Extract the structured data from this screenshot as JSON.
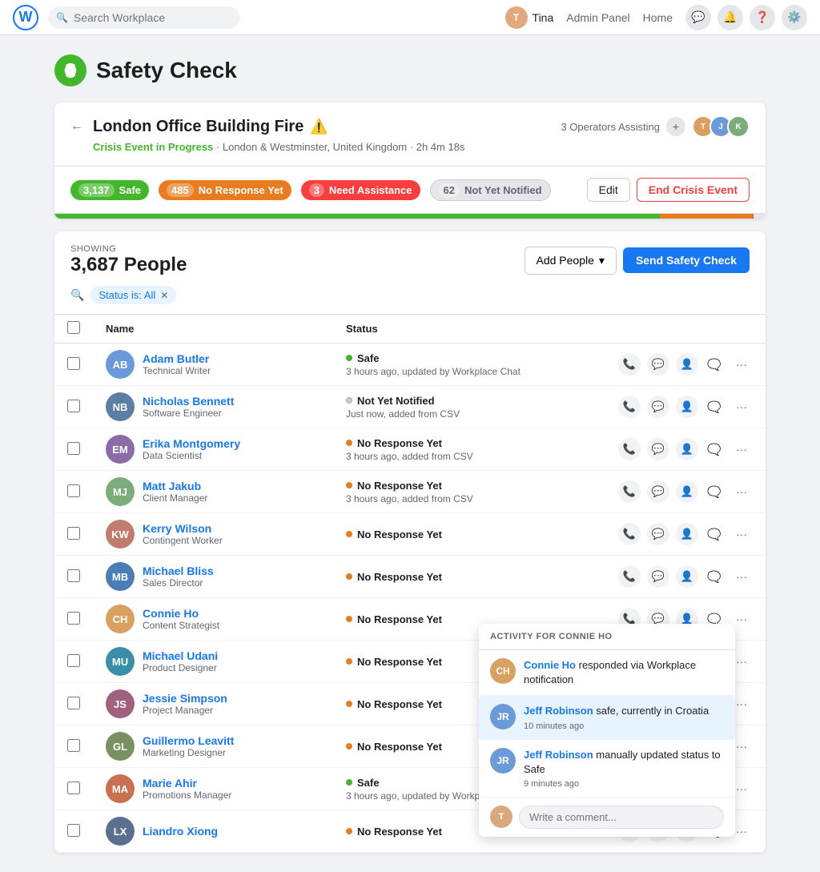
{
  "nav": {
    "logo": "W",
    "search_placeholder": "Search Workplace",
    "user_name": "Tina",
    "links": [
      "Admin Panel",
      "Home"
    ],
    "icons": [
      "chat",
      "notifications",
      "help",
      "settings"
    ]
  },
  "safety_check": {
    "title": "Safety Check",
    "crisis": {
      "name": "London Office Building Fire",
      "status": "Crisis Event in Progress",
      "location": "London & Westminster, United Kingdom",
      "time_ago": "2h 4m 18s",
      "operators_count": "3 Operators Assisting",
      "stats": {
        "safe": {
          "count": "3,137",
          "label": "Safe"
        },
        "no_response": {
          "count": "485",
          "label": "No Response Yet"
        },
        "need_assistance": {
          "count": "3",
          "label": "Need Assistance"
        },
        "not_notified": {
          "count": "62",
          "label": "Not Yet Notified"
        }
      },
      "edit_label": "Edit",
      "end_crisis_label": "End Crisis Event"
    },
    "people": {
      "showing_label": "SHOWING",
      "count": "3,687 People",
      "filter_chip": "Status is: All",
      "add_people_label": "Add People",
      "send_safety_label": "Send Safety Check",
      "columns": [
        "Name",
        "Status"
      ],
      "rows": [
        {
          "name": "Adam Butler",
          "title": "Technical Writer",
          "avatar_color": "#6a9bd8",
          "initials": "AB",
          "status_type": "safe",
          "status_name": "Safe",
          "status_sub": "3 hours ago, updated by Workplace Chat"
        },
        {
          "name": "Nicholas Bennett",
          "title": "Software Engineer",
          "avatar_color": "#5b7fa3",
          "initials": "NB",
          "status_type": "not_notified",
          "status_name": "Not Yet Notified",
          "status_sub": "Just now, added from CSV"
        },
        {
          "name": "Erika Montgomery",
          "title": "Data Scientist",
          "avatar_color": "#8b6ba8",
          "initials": "EM",
          "status_type": "no_response",
          "status_name": "No Response Yet",
          "status_sub": "3 hours ago, added from CSV"
        },
        {
          "name": "Matt Jakub",
          "title": "Client Manager",
          "avatar_color": "#7aad7a",
          "initials": "MJ",
          "status_type": "no_response",
          "status_name": "No Response Yet",
          "status_sub": "3 hours ago, added from CSV"
        },
        {
          "name": "Kerry Wilson",
          "title": "Contingent Worker",
          "avatar_color": "#c27c6e",
          "initials": "KW",
          "status_type": "no_response",
          "status_name": "No Response Yet",
          "status_sub": ""
        },
        {
          "name": "Michael Bliss",
          "title": "Sales Director",
          "avatar_color": "#4a7db5",
          "initials": "MB",
          "status_type": "no_response",
          "status_name": "No Response Yet",
          "status_sub": ""
        },
        {
          "name": "Connie Ho",
          "title": "Content Strategist",
          "avatar_color": "#d9a060",
          "initials": "CH",
          "status_type": "no_response",
          "status_name": "No Response Yet",
          "status_sub": ""
        },
        {
          "name": "Michael Udani",
          "title": "Product Designer",
          "avatar_color": "#3a8fa8",
          "initials": "MU",
          "status_type": "no_response",
          "status_name": "No Response Yet",
          "status_sub": ""
        },
        {
          "name": "Jessie Simpson",
          "title": "Project Manager",
          "avatar_color": "#a06080",
          "initials": "JS",
          "status_type": "no_response",
          "status_name": "No Response Yet",
          "status_sub": ""
        },
        {
          "name": "Guillermo Leavitt",
          "title": "Marketing Designer",
          "avatar_color": "#7a9060",
          "initials": "GL",
          "status_type": "no_response",
          "status_name": "No Response Yet",
          "status_sub": ""
        },
        {
          "name": "Marie Ahir",
          "title": "Promotions Manager",
          "avatar_color": "#c87050",
          "initials": "MA",
          "status_type": "safe",
          "status_name": "Safe",
          "status_sub": "3 hours ago, updated by Workplace Chat"
        },
        {
          "name": "Liandro Xiong",
          "title": "",
          "avatar_color": "#5a7090",
          "initials": "LX",
          "status_type": "no_response",
          "status_name": "No Response Yet",
          "status_sub": ""
        }
      ]
    },
    "activity": {
      "title": "ACTIVITY FOR CONNIE HO",
      "items": [
        {
          "avatar_color": "#d9a060",
          "initials": "CH",
          "text_before": "Connie Ho",
          "text_after": " responded via Workplace notification",
          "time": ""
        },
        {
          "avatar_color": "#6a9bd8",
          "initials": "JR",
          "text_before": "Jeff Robinson",
          "text_after": " safe, currently in Croatia",
          "time": "10 minutes ago",
          "highlighted": true
        },
        {
          "avatar_color": "#6a9bd8",
          "initials": "JR",
          "text_before": "Jeff Robinson",
          "text_after": " manually updated status to Safe",
          "time": "9 minutes ago",
          "highlighted": false
        }
      ],
      "comment_placeholder": "Write a comment...",
      "comment_avatar_color": "#d9a060",
      "comment_initials": "T"
    }
  }
}
